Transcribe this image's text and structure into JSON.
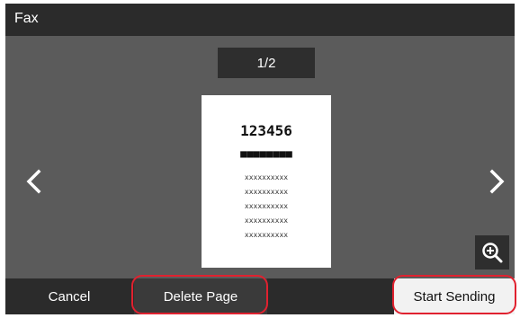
{
  "window": {
    "title": "Fax"
  },
  "preview": {
    "page_indicator": "1/2",
    "document": {
      "number": "123456",
      "dots": "■■■■■■■■",
      "lines": [
        "xxxxxxxxxx",
        "xxxxxxxxxx",
        "xxxxxxxxxx",
        "xxxxxxxxxx",
        "xxxxxxxxxx"
      ]
    }
  },
  "navigation": {
    "prev_icon": "chevron-left-icon",
    "next_icon": "chevron-right-icon"
  },
  "zoom": {
    "icon": "zoom-in-icon"
  },
  "actions": {
    "cancel_label": "Cancel",
    "delete_label": "Delete Page",
    "send_label": "Start Sending"
  },
  "colors": {
    "panel": "#5b5b5b",
    "bar": "#2b2b2b",
    "highlight": "#e0212f",
    "primary_button": "#f2f2f2"
  }
}
